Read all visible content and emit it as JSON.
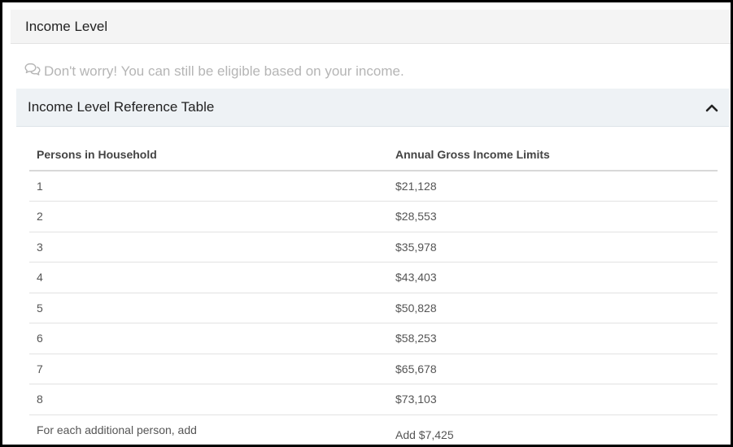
{
  "card": {
    "title": "Income Level"
  },
  "notice": {
    "icon": "comments-icon",
    "text": "Don't worry! You can still be eligible based on your income."
  },
  "accordion": {
    "title": "Income Level Reference Table",
    "expanded": true,
    "toggle_icon": "chevron-up-icon"
  },
  "table": {
    "headers": [
      "Persons in Household",
      "Annual Gross Income Limits"
    ],
    "rows": [
      [
        "1",
        "$21,128"
      ],
      [
        "2",
        "$28,553"
      ],
      [
        "3",
        "$35,978"
      ],
      [
        "4",
        "$43,403"
      ],
      [
        "5",
        "$50,828"
      ],
      [
        "6",
        "$58,253"
      ],
      [
        "7",
        "$65,678"
      ],
      [
        "8",
        "$73,103"
      ],
      [
        "For each additional person, add",
        "Add $7,425"
      ]
    ]
  },
  "colors": {
    "header_bg": "#f4f4f4",
    "accordion_bg": "#eef2f5",
    "notice_text": "#b5b5b5",
    "frame_border": "#000000"
  }
}
